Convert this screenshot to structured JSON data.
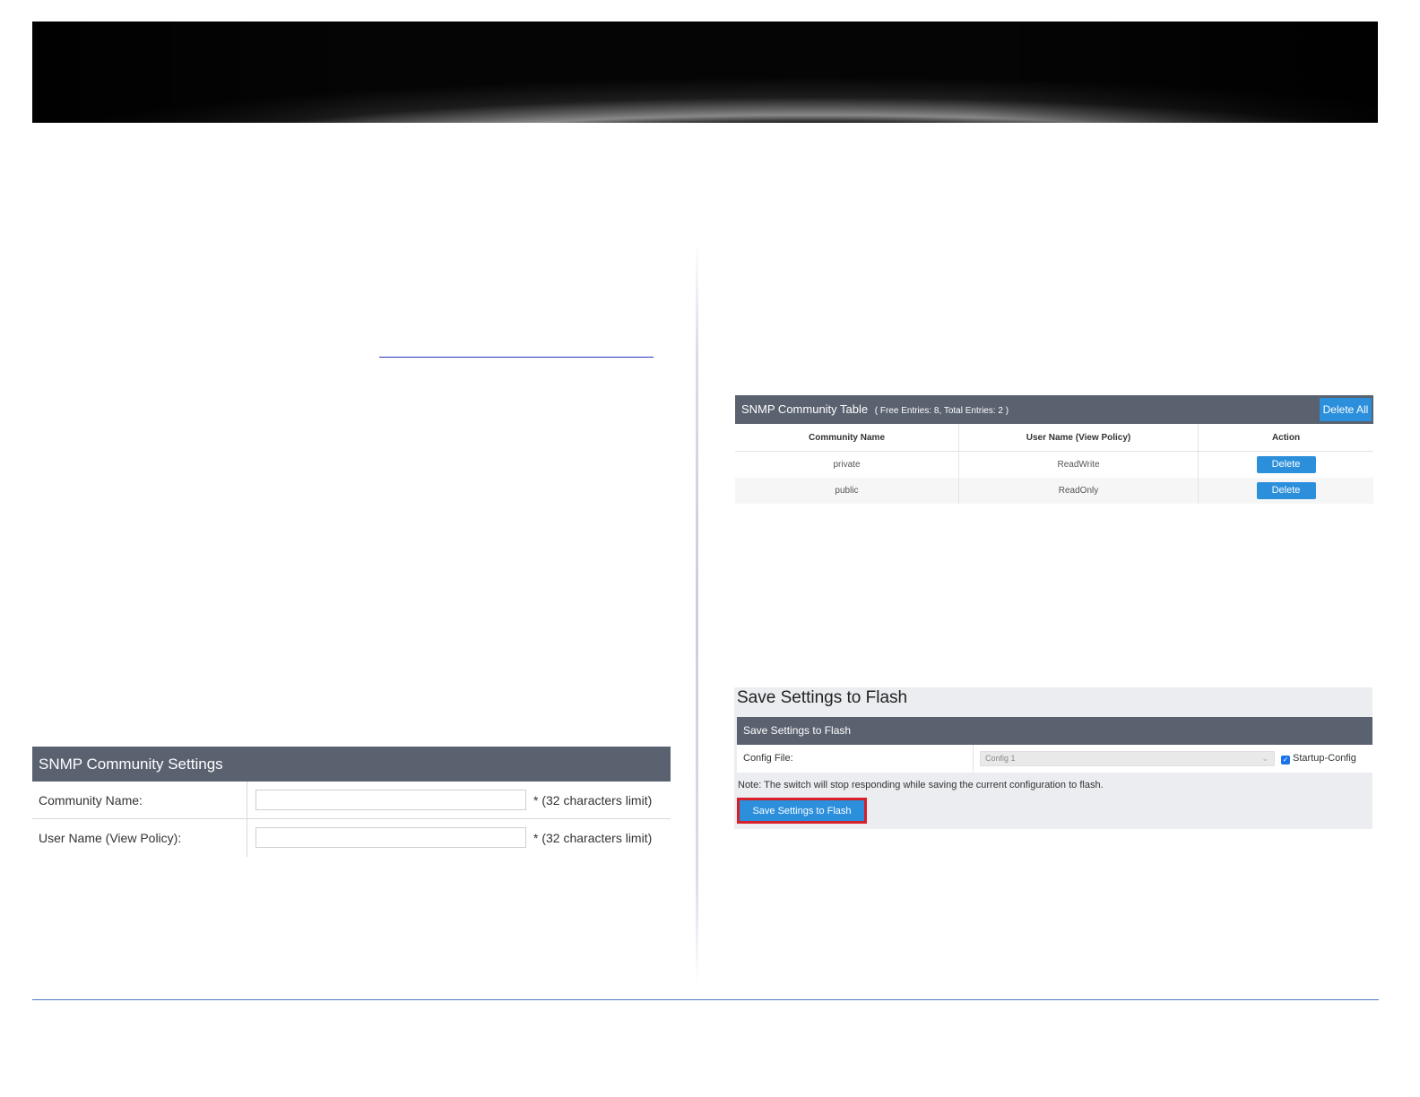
{
  "settings": {
    "title": "SNMP Community Settings",
    "community_name_label": "Community Name:",
    "community_name_value": "",
    "community_name_hint": "* (32 characters limit)",
    "user_name_label": "User Name (View Policy):",
    "user_name_value": "",
    "user_name_hint": "* (32 characters limit)"
  },
  "community_table": {
    "title": "SNMP Community Table",
    "subtitle": "( Free Entries: 8, Total Entries: 2 )",
    "delete_all_label": "Delete All",
    "columns": [
      "Community Name",
      "User Name (View Policy)",
      "Action"
    ],
    "rows": [
      {
        "community": "private",
        "user_name": "ReadWrite",
        "action": "Delete"
      },
      {
        "community": "public",
        "user_name": "ReadOnly",
        "action": "Delete"
      }
    ]
  },
  "flash": {
    "page_title": "Save Settings to Flash",
    "section_title": "Save Settings to Flash",
    "config_file_label": "Config File:",
    "config_file_value": "Config 1",
    "startup_config_label": "Startup-Config",
    "startup_config_checked": true,
    "note": "Note: The switch will stop responding while saving the current configuration to flash.",
    "button_label": "Save Settings to Flash"
  },
  "colors": {
    "header_bar": "#5a6270",
    "button_blue": "#2b8fdc",
    "highlight_red": "#d6202a",
    "footer_line": "#4a7cc4"
  }
}
